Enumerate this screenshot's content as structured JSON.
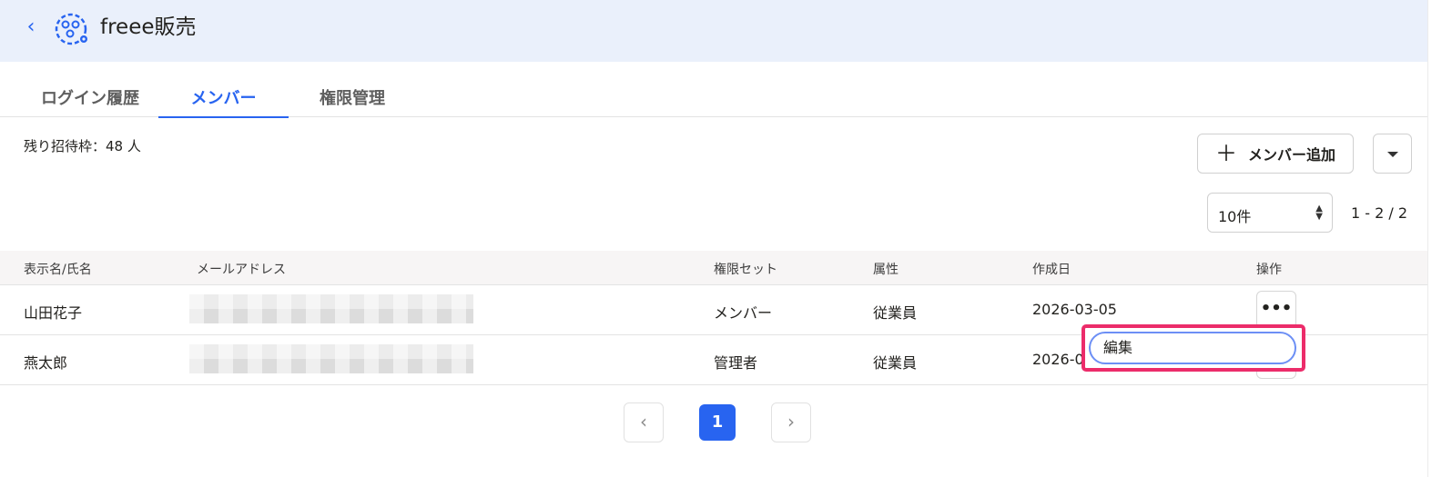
{
  "header": {
    "app_name": "freee販売"
  },
  "tabs": [
    {
      "label": "ログイン履歴"
    },
    {
      "label": "メンバー"
    },
    {
      "label": "権限管理"
    }
  ],
  "remaining_invites": "残り招待枠：48 人",
  "toolbar": {
    "add_member_label": "メンバー追加"
  },
  "pagination": {
    "per_page": "10件",
    "range": "1 - 2 / 2",
    "current_page": "1"
  },
  "table": {
    "headers": [
      "表示名/氏名",
      "メールアドレス",
      "権限セット",
      "属性",
      "作成日",
      "操作"
    ],
    "rows": [
      {
        "name": "山田花子",
        "role": "メンバー",
        "attribute": "従業員",
        "created": "2026-03-05"
      },
      {
        "name": "燕太郎",
        "role": "管理者",
        "attribute": "従業員",
        "created": "2026-0"
      }
    ]
  },
  "context_menu": {
    "edit_label": "編集"
  },
  "colors": {
    "accent": "#2864f0",
    "header_bg": "#eaf0fb",
    "highlight": "#ec2c6a"
  }
}
